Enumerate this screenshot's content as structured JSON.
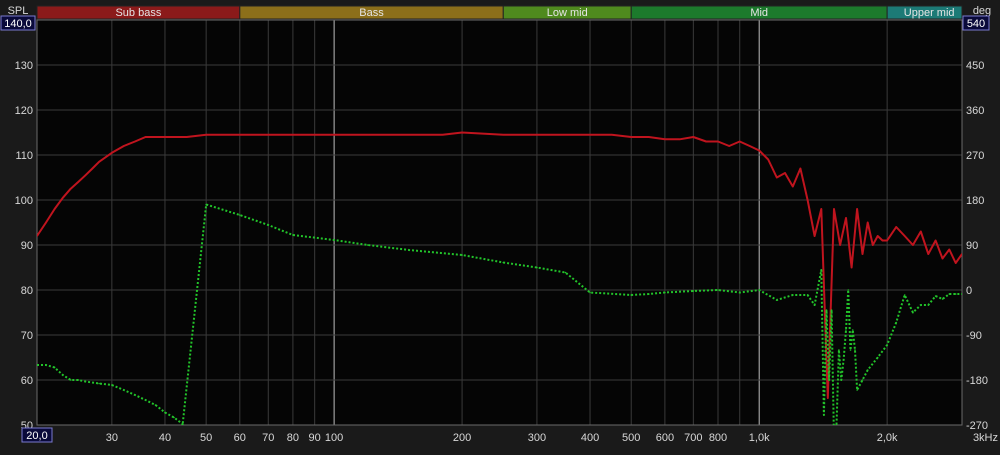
{
  "chart_data": {
    "type": "line",
    "xscale": "log",
    "xlim": [
      20,
      3000
    ],
    "ylim_left": [
      50,
      140
    ],
    "ylim_right": [
      -270,
      540
    ],
    "ylabel_left": "SPL",
    "ylabel_right": "deg",
    "ymin_box": "140,0",
    "ymax_box_right": "540",
    "xmin_box": "20,0",
    "x_ticks": [
      {
        "v": 30,
        "l": "30"
      },
      {
        "v": 40,
        "l": "40"
      },
      {
        "v": 50,
        "l": "50"
      },
      {
        "v": 60,
        "l": "60"
      },
      {
        "v": 70,
        "l": "70"
      },
      {
        "v": 80,
        "l": "80"
      },
      {
        "v": 90,
        "l": "90"
      },
      {
        "v": 100,
        "l": "100"
      },
      {
        "v": 200,
        "l": "200"
      },
      {
        "v": 300,
        "l": "300"
      },
      {
        "v": 400,
        "l": "400"
      },
      {
        "v": 500,
        "l": "500"
      },
      {
        "v": 600,
        "l": "600"
      },
      {
        "v": 700,
        "l": "700"
      },
      {
        "v": 800,
        "l": "800"
      },
      {
        "v": 1000,
        "l": "1,0k"
      },
      {
        "v": 2000,
        "l": "2,0k"
      },
      {
        "v": 3000,
        "l": "3kHz"
      }
    ],
    "y_left_ticks": [
      {
        "v": 130,
        "l": "130"
      },
      {
        "v": 120,
        "l": "120"
      },
      {
        "v": 110,
        "l": "110"
      },
      {
        "v": 100,
        "l": "100"
      },
      {
        "v": 90,
        "l": "90"
      },
      {
        "v": 80,
        "l": "80"
      },
      {
        "v": 70,
        "l": "70"
      },
      {
        "v": 60,
        "l": "60"
      },
      {
        "v": 50,
        "l": "50"
      }
    ],
    "y_right_ticks": [
      {
        "v": 450,
        "l": "450"
      },
      {
        "v": 360,
        "l": "360"
      },
      {
        "v": 270,
        "l": "270"
      },
      {
        "v": 180,
        "l": "180"
      },
      {
        "v": 90,
        "l": "90"
      },
      {
        "v": 0,
        "l": "0"
      },
      {
        "v": -90,
        "l": "-90"
      },
      {
        "v": -180,
        "l": "-180"
      },
      {
        "v": -270,
        "l": "-270"
      }
    ],
    "bands": [
      {
        "label": "Sub bass",
        "from": 20,
        "to": 60,
        "color": "#8b1a1a"
      },
      {
        "label": "Bass",
        "from": 60,
        "to": 250,
        "color": "#8c6f1a"
      },
      {
        "label": "Low mid",
        "from": 250,
        "to": 500,
        "color": "#4f8a1e"
      },
      {
        "label": "Mid",
        "from": 500,
        "to": 2000,
        "color": "#1c7a2c"
      },
      {
        "label": "Upper mid",
        "from": 2000,
        "to": 3000,
        "color": "#1c7a76"
      }
    ],
    "colors": {
      "spl": "#c0141e",
      "phase": "#22c42a",
      "grid": "#3a3a3a",
      "highlight": "#bdbdbd",
      "plot_bg": "#050505"
    },
    "series": [
      {
        "axis": "left",
        "x": [
          20,
          21,
          22,
          23,
          24,
          25,
          26,
          27,
          28,
          30,
          32,
          34,
          36,
          38,
          40,
          45,
          50,
          60,
          70,
          80,
          100,
          120,
          150,
          180,
          200,
          250,
          300,
          350,
          400,
          450,
          500,
          550,
          600,
          650,
          700,
          750,
          800,
          850,
          900,
          950,
          1000,
          1050,
          1100,
          1150,
          1200,
          1250,
          1300,
          1350,
          1400,
          1450,
          1500,
          1550,
          1600,
          1650,
          1700,
          1750,
          1800,
          1850,
          1900,
          1950,
          2000,
          2100,
          2200,
          2300,
          2400,
          2500,
          2600,
          2700,
          2800,
          2900,
          3000
        ],
        "y": [
          92,
          95,
          98,
          100.5,
          102.5,
          104,
          105.5,
          107,
          108.5,
          110.5,
          112,
          113,
          114,
          114,
          114,
          114,
          114.5,
          114.5,
          114.5,
          114.5,
          114.5,
          114.5,
          114.5,
          114.5,
          115,
          114.5,
          114.5,
          114.5,
          114.5,
          114.5,
          114,
          114,
          113.5,
          113.5,
          114,
          113,
          113,
          112,
          113,
          112,
          111,
          109,
          105,
          106,
          103,
          107,
          100,
          92,
          98,
          56,
          98,
          90,
          96,
          85,
          98,
          88,
          95,
          90,
          92,
          91,
          91,
          94,
          92,
          90,
          93,
          88,
          91,
          87,
          89,
          86,
          88
        ]
      },
      {
        "axis": "right",
        "x": [
          20,
          21,
          22,
          23,
          24,
          25,
          26,
          28,
          30,
          32,
          34,
          36,
          38,
          40,
          42,
          44,
          44.01,
          50,
          60,
          70,
          80,
          100,
          120,
          150,
          200,
          250,
          300,
          350,
          400,
          500,
          550,
          600,
          700,
          800,
          900,
          1000,
          1100,
          1200,
          1300,
          1350,
          1400,
          1420,
          1440,
          1460,
          1480,
          1500,
          1520,
          1540,
          1560,
          1580,
          1600,
          1620,
          1640,
          1660,
          1680,
          1700,
          1750,
          1800,
          1900,
          2000,
          2100,
          2200,
          2300,
          2400,
          2500,
          2600,
          2700,
          2800,
          2900,
          3000
        ],
        "y": [
          -150,
          -150,
          -155,
          -170,
          -180,
          -180,
          -183,
          -187,
          -190,
          -200,
          -210,
          -220,
          -230,
          -245,
          -255,
          -268,
          -270,
          171,
          150,
          130,
          110,
          100,
          90,
          80,
          70,
          55,
          45,
          35,
          -5,
          -10,
          -8,
          -5,
          -2,
          0,
          -5,
          0,
          -20,
          -10,
          -10,
          -30,
          40,
          -250,
          -40,
          -180,
          -40,
          -300,
          -270,
          -120,
          -180,
          -140,
          -80,
          0,
          -120,
          -80,
          -120,
          -200,
          -180,
          -160,
          -135,
          -110,
          -65,
          -10,
          -45,
          -30,
          -30,
          -12,
          -18,
          -8,
          -8,
          -8
        ]
      }
    ]
  }
}
